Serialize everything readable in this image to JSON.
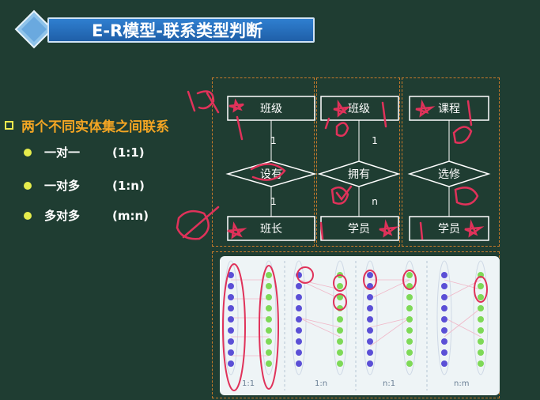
{
  "title": "E-R模型-联系类型判断",
  "heading": "两个不同实体集之间联系",
  "relation_types": [
    {
      "name": "一对一",
      "notation": "(1:1)"
    },
    {
      "name": "一对多",
      "notation": "(1:n)"
    },
    {
      "name": "多对多",
      "notation": "(m:n)"
    }
  ],
  "er_diagrams": [
    {
      "entity_top": "班级",
      "card_top": "1",
      "relation": "设有",
      "card_bottom": "1",
      "entity_bottom": "班长"
    },
    {
      "entity_top": "班级",
      "card_top": "1",
      "relation": "拥有",
      "card_bottom": "n",
      "entity_bottom": "学员"
    },
    {
      "entity_top": "课程",
      "card_top": "",
      "relation": "选修",
      "card_bottom": "",
      "entity_bottom": "学员"
    }
  ],
  "mapping_labels": [
    "1:1",
    "1:n",
    "n:1",
    "n:m"
  ],
  "colors": {
    "background": "#1f3d32",
    "title_blue": "#2f7fd0",
    "heading_orange": "#f5a623",
    "bullet_yellow": "#e6ec4c",
    "annotation_red": "#e0325a",
    "dot_blue": "#5b4fd6",
    "dot_green": "#7ed957"
  }
}
